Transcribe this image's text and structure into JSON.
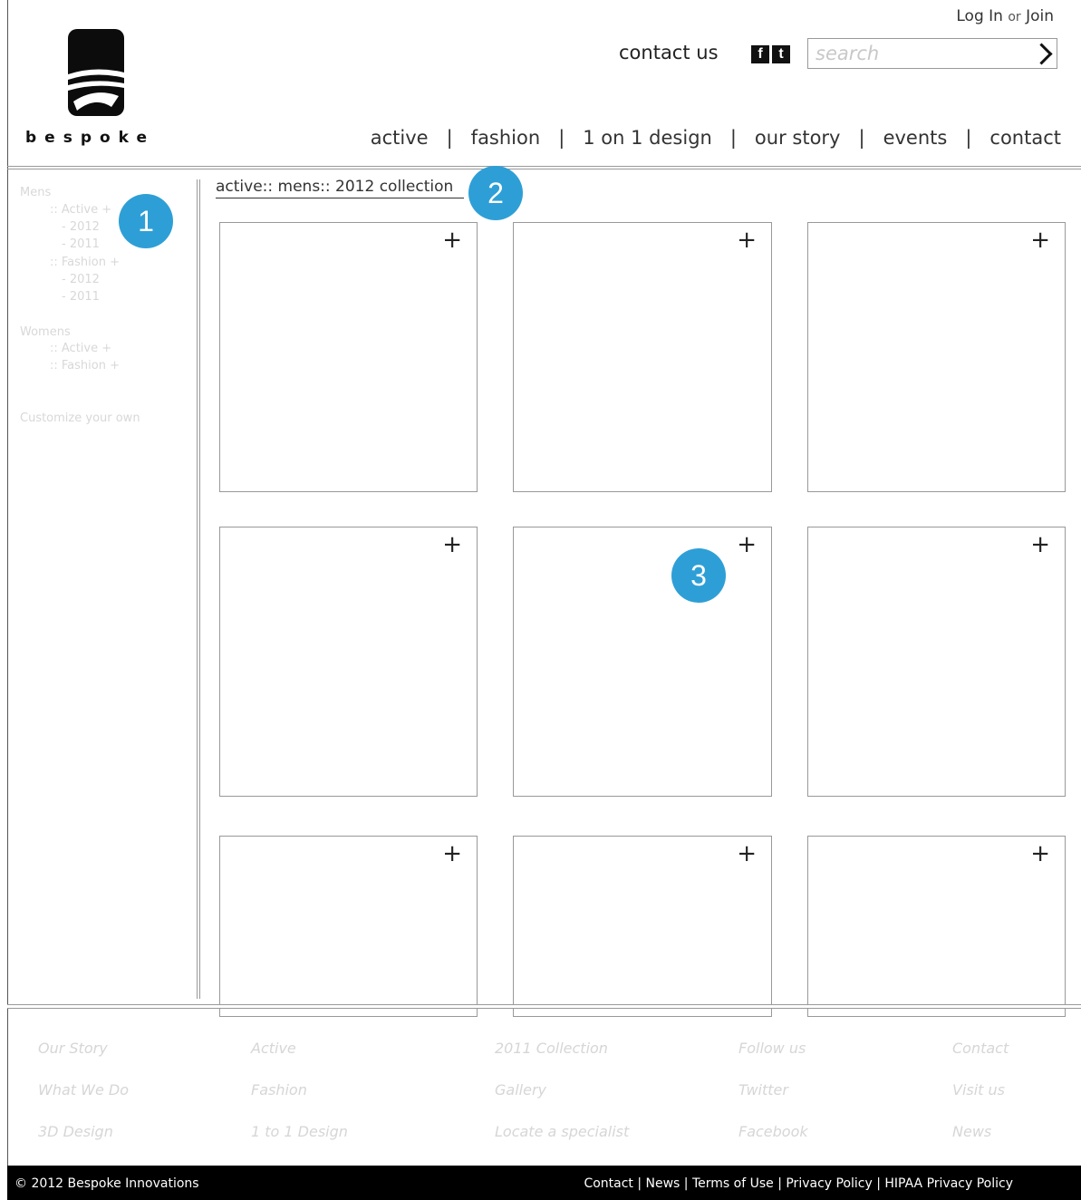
{
  "header": {
    "login": "Log In",
    "or": "or",
    "join": "Join",
    "brand": "bespoke",
    "contact_us": "contact us",
    "social": [
      "f",
      "t"
    ],
    "search_placeholder": "search",
    "nav": [
      "active",
      "fashion",
      "1 on 1 design",
      "our story",
      "events",
      "contact"
    ]
  },
  "sidebar": {
    "mens": "Mens",
    "mens_active": ":: Active +",
    "mens_active_2012": "- 2012",
    "mens_active_2011": "- 2011",
    "mens_fashion": ":: Fashion +",
    "mens_fashion_2012": "- 2012",
    "mens_fashion_2011": "- 2011",
    "womens": "Womens",
    "womens_active": ":: Active +",
    "womens_fashion": ":: Fashion +",
    "customize": "Customize your own"
  },
  "breadcrumb": "active:: mens:: 2012 collection",
  "badges": [
    "1",
    "2",
    "3"
  ],
  "tiles": {
    "plus": "+"
  },
  "footer": {
    "col1": [
      "Our Story",
      "What We Do",
      "3D Design"
    ],
    "col2": [
      "Active",
      "Fashion",
      "1 to 1 Design"
    ],
    "col3": [
      "2011 Collection",
      "Gallery",
      "Locate a specialist"
    ],
    "col4": [
      "Follow us",
      "Twitter",
      "Facebook"
    ],
    "col5": [
      "Contact",
      "Visit us",
      "News"
    ],
    "copyright": "© 2012 Bespoke Innovations",
    "bottom_links": "Contact | News | Terms of Use | Privacy Policy | HIPAA Privacy Policy"
  },
  "colors": {
    "badge": "#2e9fd6",
    "bottom_bar": "#000000"
  }
}
